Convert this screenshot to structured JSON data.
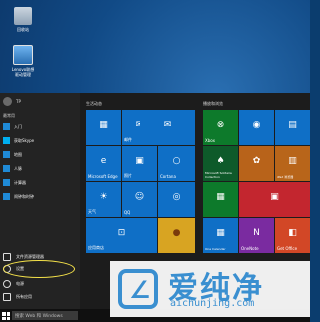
{
  "desktop": {
    "icons": [
      {
        "label": "回收站",
        "icon": "recycle-bin-icon"
      },
      {
        "label": "Lenovo联想\n驱动管理",
        "icon": "lenovo-driver-icon"
      }
    ]
  },
  "start": {
    "user": "TP",
    "most_used_title": "最常用",
    "apps": [
      {
        "label": "入门",
        "icon": "getstarted-icon"
      },
      {
        "label": "获取Skype",
        "icon": "skype-icon"
      },
      {
        "label": "地图",
        "icon": "maps-icon"
      },
      {
        "label": "人脉",
        "icon": "people-icon"
      },
      {
        "label": "计算器",
        "icon": "calculator-icon"
      },
      {
        "label": "闹钟和时钟",
        "icon": "alarm-icon"
      }
    ],
    "bottom": [
      {
        "label": "文件资源管理器",
        "icon": "folder-icon"
      },
      {
        "label": "设置",
        "icon": "gear-icon"
      },
      {
        "label": "电源",
        "icon": "power-icon"
      },
      {
        "label": "所有应用",
        "icon": "list-icon"
      }
    ],
    "groups": [
      "生活动态",
      "播放和浏览"
    ],
    "tiles": {
      "mail": "",
      "calendar": "邮件",
      "edge": "Microsoft Edge",
      "photos": "照片",
      "cortana": "Cortana",
      "weather": "天气",
      "qq": "QQ",
      "store": "应用商店",
      "xbox": "Xbox",
      "solitaire": "Microsoft Solitaire Collection",
      "candy": "",
      "onenote": "OneNote",
      "onecal": "One Calendar",
      "office": "",
      "getoffice": "Get Office",
      "ipad": "iPad 浏览器",
      "voice": ""
    }
  },
  "taskbar": {
    "search_placeholder": "搜索 Web 和 Windows"
  },
  "watermark": {
    "text": "爱纯净",
    "url": "aichunjing.com"
  },
  "colors": {
    "tile_blue": "#0f6fc6",
    "tile_green": "#0d7a2b",
    "tile_red": "#c3262f",
    "highlight": "#f5e24a"
  }
}
